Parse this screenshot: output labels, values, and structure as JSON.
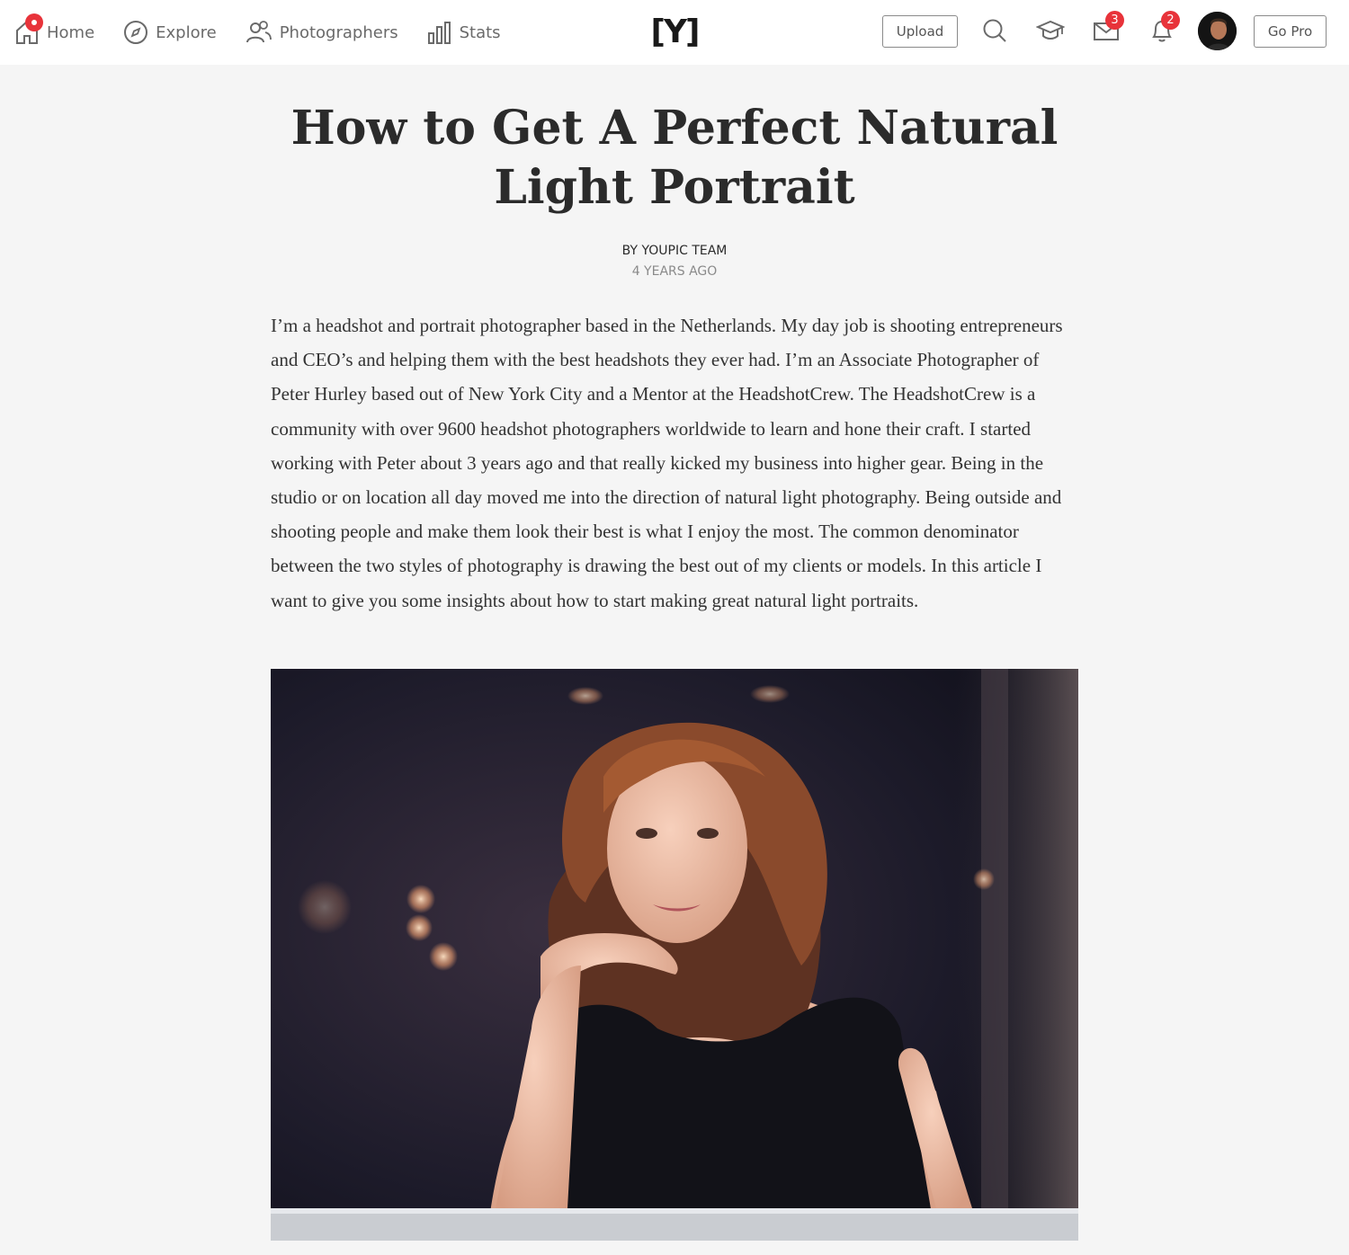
{
  "nav": {
    "home_label": "Home",
    "explore_label": "Explore",
    "photographers_label": "Photographers",
    "stats_label": "Stats",
    "logo_text": "[Y]",
    "upload_label": "Upload",
    "gopro_label": "Go Pro",
    "mail_badge": "3",
    "notifications_badge": "2",
    "icons": [
      "home-icon",
      "compass-icon",
      "people-icon",
      "bar-chart-icon",
      "search-icon",
      "graduation-cap-icon",
      "mail-icon",
      "bell-icon"
    ]
  },
  "article": {
    "title": "How to Get A Perfect Natural Light Portrait",
    "byline": "BY YOUPIC TEAM",
    "age": "4 YEARS AGO",
    "body": "I’m a headshot and portrait photographer based in the Netherlands. My day job is shooting entrepreneurs and CEO’s and helping them with the best headshots they ever had. I’m an Associate Photographer of Peter Hurley based out of New York City and a Mentor at the HeadshotCrew. The HeadshotCrew is a community with over 9600 headshot photographers worldwide to learn and hone their craft. I started working with Peter about 3 years ago and that really kicked my business into higher gear. Being in the studio or on location all day moved me into the direction of natural light photography. Being outside and shooting people and make them look their best is what I enjoy the most. The common denominator between the two styles of photography is drawing the best out of my clients or models. In this article I want to give you some insights about how to start making great natural light portraits."
  },
  "colors": {
    "accent_red": "#e8333a",
    "page_bg": "#f5f5f5",
    "text_dark": "#2b2b2b",
    "text_muted": "#8a8a8a"
  }
}
